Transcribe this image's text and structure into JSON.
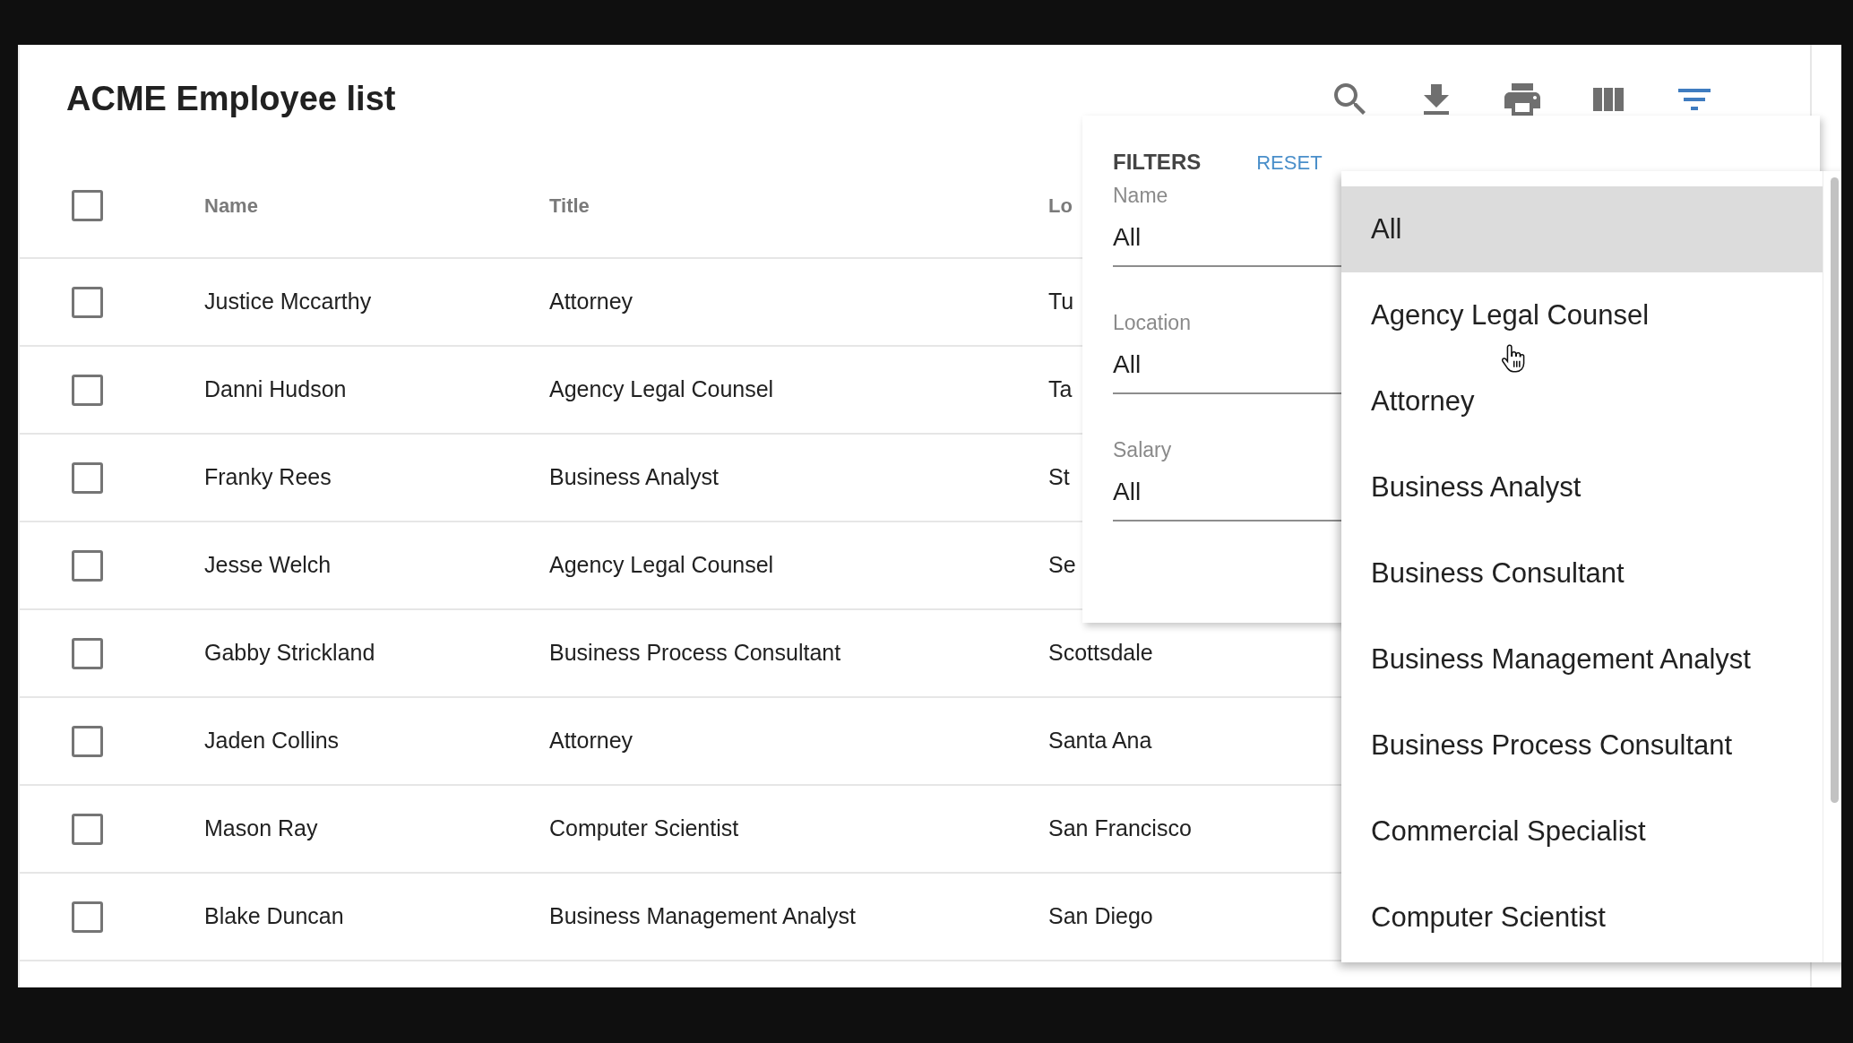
{
  "page": {
    "title": "ACME Employee list"
  },
  "toolbar": [
    {
      "kind": "search",
      "active": false
    },
    {
      "kind": "download",
      "active": false
    },
    {
      "kind": "print",
      "active": false
    },
    {
      "kind": "columns",
      "active": false
    },
    {
      "kind": "filter",
      "active": true
    }
  ],
  "table": {
    "select_all": {
      "checked": false
    },
    "columns": [
      {
        "label": "Name"
      },
      {
        "label": "Title"
      },
      {
        "label": "Lo"
      }
    ],
    "rows": [
      {
        "checked": false,
        "name": "Justice Mccarthy",
        "title": "Attorney",
        "column_3": "Tu"
      },
      {
        "checked": false,
        "name": "Danni Hudson",
        "title": "Agency Legal Counsel",
        "column_3": "Ta"
      },
      {
        "checked": false,
        "name": "Franky Rees",
        "title": "Business Analyst",
        "column_3": "St"
      },
      {
        "checked": false,
        "name": "Jesse Welch",
        "title": "Agency Legal Counsel",
        "column_3": "Se"
      },
      {
        "checked": false,
        "name": "Gabby Strickland",
        "title": "Business Process Consultant",
        "column_3": "Scottsdale"
      },
      {
        "checked": false,
        "name": "Jaden Collins",
        "title": "Attorney",
        "column_3": "Santa Ana"
      },
      {
        "checked": false,
        "name": "Mason Ray",
        "title": "Computer Scientist",
        "column_3": "San Francisco"
      },
      {
        "checked": false,
        "name": "Blake Duncan",
        "title": "Business Management Analyst",
        "column_3": "San Diego"
      }
    ]
  },
  "filters": {
    "heading": "FILTERS",
    "reset": "RESET",
    "fields": [
      {
        "label": "Name",
        "value": "All"
      },
      {
        "label": "Location",
        "value": "All"
      },
      {
        "label": "Salary",
        "value": "All"
      }
    ]
  },
  "dropdown_menu": {
    "options": [
      {
        "label": "All",
        "selected": true
      },
      {
        "label": "Agency Legal Counsel",
        "selected": false
      },
      {
        "label": "Attorney",
        "selected": false
      },
      {
        "label": "Business Analyst",
        "selected": false
      },
      {
        "label": "Business Consultant",
        "selected": false
      },
      {
        "label": "Business Management Analyst",
        "selected": false
      },
      {
        "label": "Business Process Consultant",
        "selected": false
      },
      {
        "label": "Commercial Specialist",
        "selected": false
      },
      {
        "label": "Computer Scientist",
        "selected": false
      }
    ]
  }
}
